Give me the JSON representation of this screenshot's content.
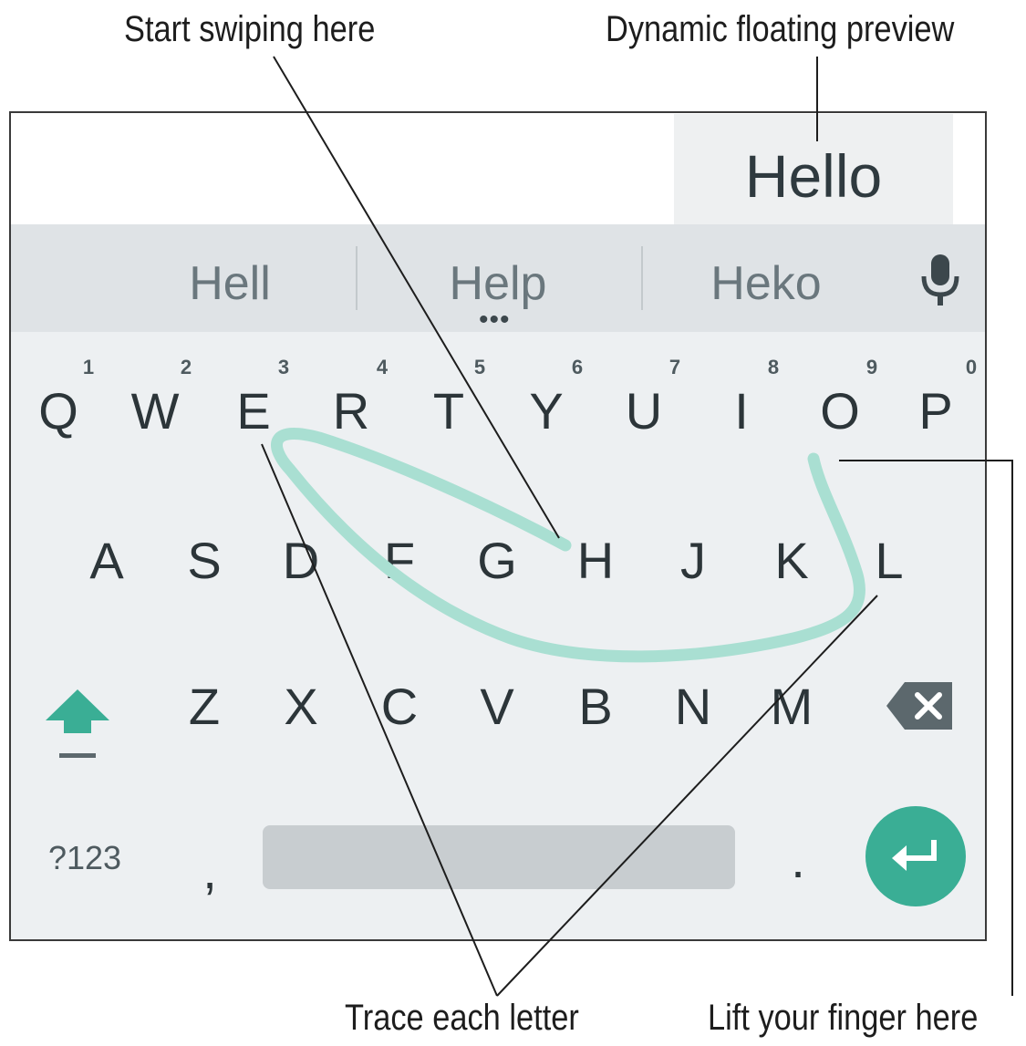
{
  "callouts": {
    "start_swiping": "Start swiping here",
    "floating_preview": "Dynamic floating preview",
    "trace_letters": "Trace each letter",
    "lift_finger": "Lift your finger here"
  },
  "preview": {
    "word": "Hello"
  },
  "suggestions": [
    "Hell",
    "Help",
    "Heko"
  ],
  "suggestion_more": "•••",
  "keyboard": {
    "row1": [
      {
        "key": "Q",
        "hint": "1"
      },
      {
        "key": "W",
        "hint": "2"
      },
      {
        "key": "E",
        "hint": "3"
      },
      {
        "key": "R",
        "hint": "4"
      },
      {
        "key": "T",
        "hint": "5"
      },
      {
        "key": "Y",
        "hint": "6"
      },
      {
        "key": "U",
        "hint": "7"
      },
      {
        "key": "I",
        "hint": "8"
      },
      {
        "key": "O",
        "hint": "9"
      },
      {
        "key": "P",
        "hint": "0"
      }
    ],
    "row2": [
      "A",
      "S",
      "D",
      "F",
      "G",
      "H",
      "J",
      "K",
      "L"
    ],
    "row3": [
      "Z",
      "X",
      "C",
      "V",
      "B",
      "N",
      "M"
    ],
    "symbols_label": "?123",
    "comma": ",",
    "period": "."
  },
  "icons": {
    "mic": "microphone-icon",
    "shift": "shift-arrow-icon",
    "backspace": "backspace-icon",
    "enter": "enter-return-icon"
  },
  "colors": {
    "accent": "#3aae95",
    "swipe_trail": "#a9dfd2",
    "suggestion_bar": "#dfe3e6",
    "keys_background": "#edf0f2"
  }
}
